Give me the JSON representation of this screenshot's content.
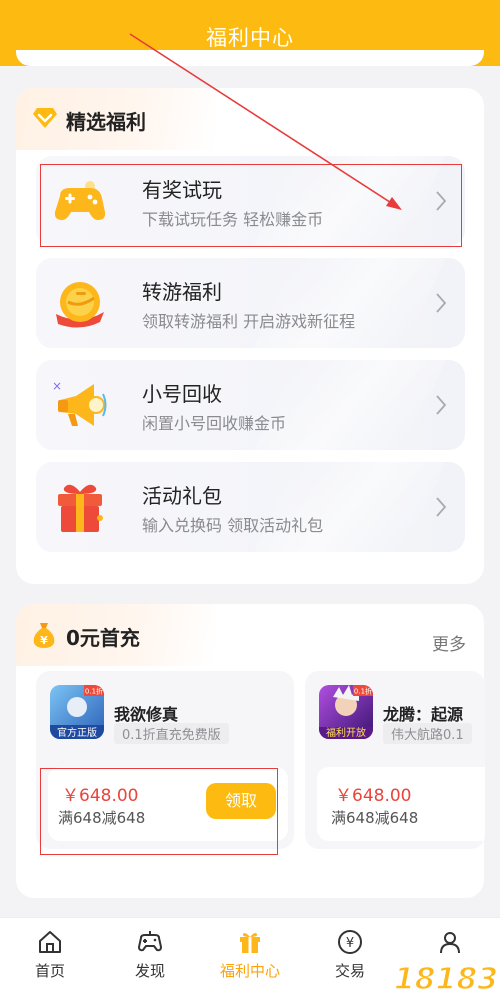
{
  "header": {
    "title": "福利中心"
  },
  "welfare": {
    "title": "精选福利",
    "items": [
      {
        "name": "有奖试玩",
        "desc": "下载试玩任务 轻松赚金币"
      },
      {
        "name": "转游福利",
        "desc": "领取转游福利 开启游戏新征程"
      },
      {
        "name": "小号回收",
        "desc": "闲置小号回收赚金币"
      },
      {
        "name": "活动礼包",
        "desc": "输入兑换码 领取活动礼包"
      }
    ]
  },
  "first_charge": {
    "title": "0元首充",
    "more": "更多",
    "games": [
      {
        "name": "我欲修真",
        "tag": "0.1折直充免费版",
        "badge": "0.1折",
        "cover_text": "官方正版",
        "price": "￥648.00",
        "condition": "满648减648",
        "button": "领取"
      },
      {
        "name": "龙腾：起源",
        "tag": "伟大航路0.1",
        "badge": "0.1折",
        "cover_text": "福利开放",
        "price": "￥648.00",
        "condition": "满648减648"
      }
    ]
  },
  "nav": {
    "items": [
      {
        "label": "首页"
      },
      {
        "label": "发现"
      },
      {
        "label": "福利中心"
      },
      {
        "label": "交易"
      }
    ]
  },
  "watermark": {
    "text": "18183"
  },
  "colors": {
    "brand": "#fdbb11",
    "price": "#e9453b",
    "annotation": "#e83b3b",
    "active_nav": "#fda20d"
  }
}
